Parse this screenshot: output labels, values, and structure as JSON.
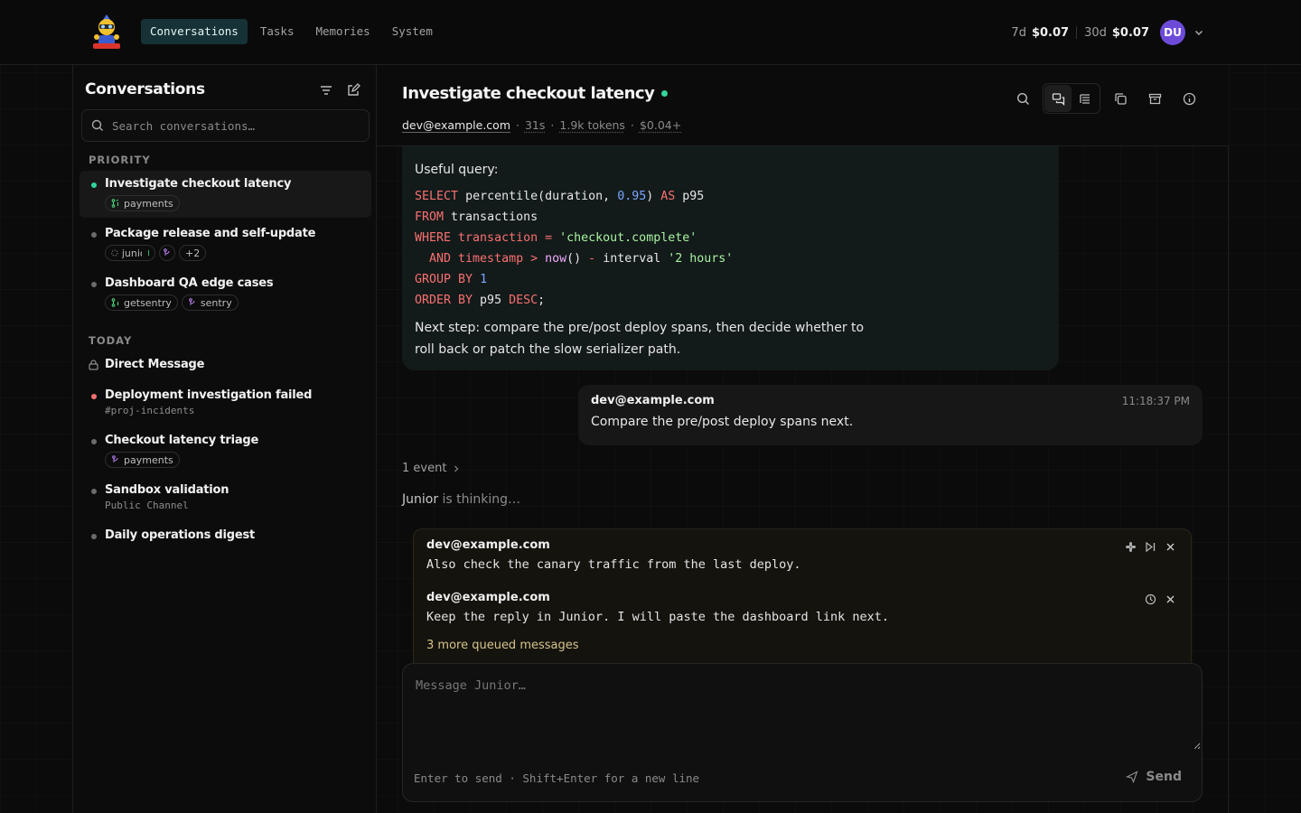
{
  "topbar": {
    "tabs": [
      {
        "label": "Conversations",
        "active": true
      },
      {
        "label": "Tasks",
        "active": false
      },
      {
        "label": "Memories",
        "active": false
      },
      {
        "label": "System",
        "active": false
      }
    ],
    "cost_7d_label": "7d",
    "cost_7d_value": "$0.07",
    "cost_30d_label": "30d",
    "cost_30d_value": "$0.07",
    "avatar_initials": "DU"
  },
  "sidebar": {
    "title": "Conversations",
    "search_placeholder": "Search conversations…",
    "sections": {
      "priority": "PRIORITY",
      "today": "TODAY"
    },
    "priority_items": [
      {
        "title": "Investigate checkout latency",
        "tags": [
          "payments"
        ],
        "dot_color": "#34d399"
      },
      {
        "title": "Package release and self-update",
        "tags": [
          "junior",
          "+2"
        ]
      },
      {
        "title": "Dashboard QA edge cases",
        "tags": [
          "getsentry",
          "sentry"
        ]
      }
    ],
    "today_items": [
      {
        "title": "Direct Message"
      },
      {
        "title": "Deployment investigation failed",
        "sub": "#proj-incidents",
        "dot_color": "#f87171"
      },
      {
        "title": "Checkout latency triage",
        "tags": [
          "payments"
        ]
      },
      {
        "title": "Sandbox validation",
        "sub": "Public Channel"
      },
      {
        "title": "Daily operations digest"
      }
    ]
  },
  "chat": {
    "title": "Investigate checkout latency",
    "meta": {
      "user": "dev@example.com",
      "duration": "31s",
      "tokens": "1.9k tokens",
      "cost": "$0.04+"
    },
    "ai_message": {
      "intro": "Useful query:",
      "code_lines": [
        "SELECT percentile(duration, 0.95) AS p95",
        "FROM transactions",
        "WHERE transaction = 'checkout.complete'",
        "  AND timestamp > now() - interval '2 hours'",
        "GROUP BY 1",
        "ORDER BY p95 DESC;"
      ],
      "outro_1": "Next step: compare the pre/post deploy spans, then decide whether to",
      "outro_2": "roll back or patch the slow serializer path."
    },
    "user_message": {
      "name": "dev@example.com",
      "time": "11:18:37 PM",
      "text": "Compare the pre/post deploy spans next."
    },
    "event_label": "1 event",
    "thinking_name": "Junior",
    "thinking_text": " is thinking…",
    "queue": [
      {
        "name": "dev@example.com",
        "text": "Also check the canary traffic from the last deploy."
      },
      {
        "name": "dev@example.com",
        "text": "Keep the reply in Junior. I will paste the dashboard link next."
      }
    ],
    "queue_more": "3 more queued messages",
    "composer": {
      "placeholder": "Message Junior…",
      "hint": "Enter to send · Shift+Enter for a new line",
      "send_label": "Send"
    }
  }
}
